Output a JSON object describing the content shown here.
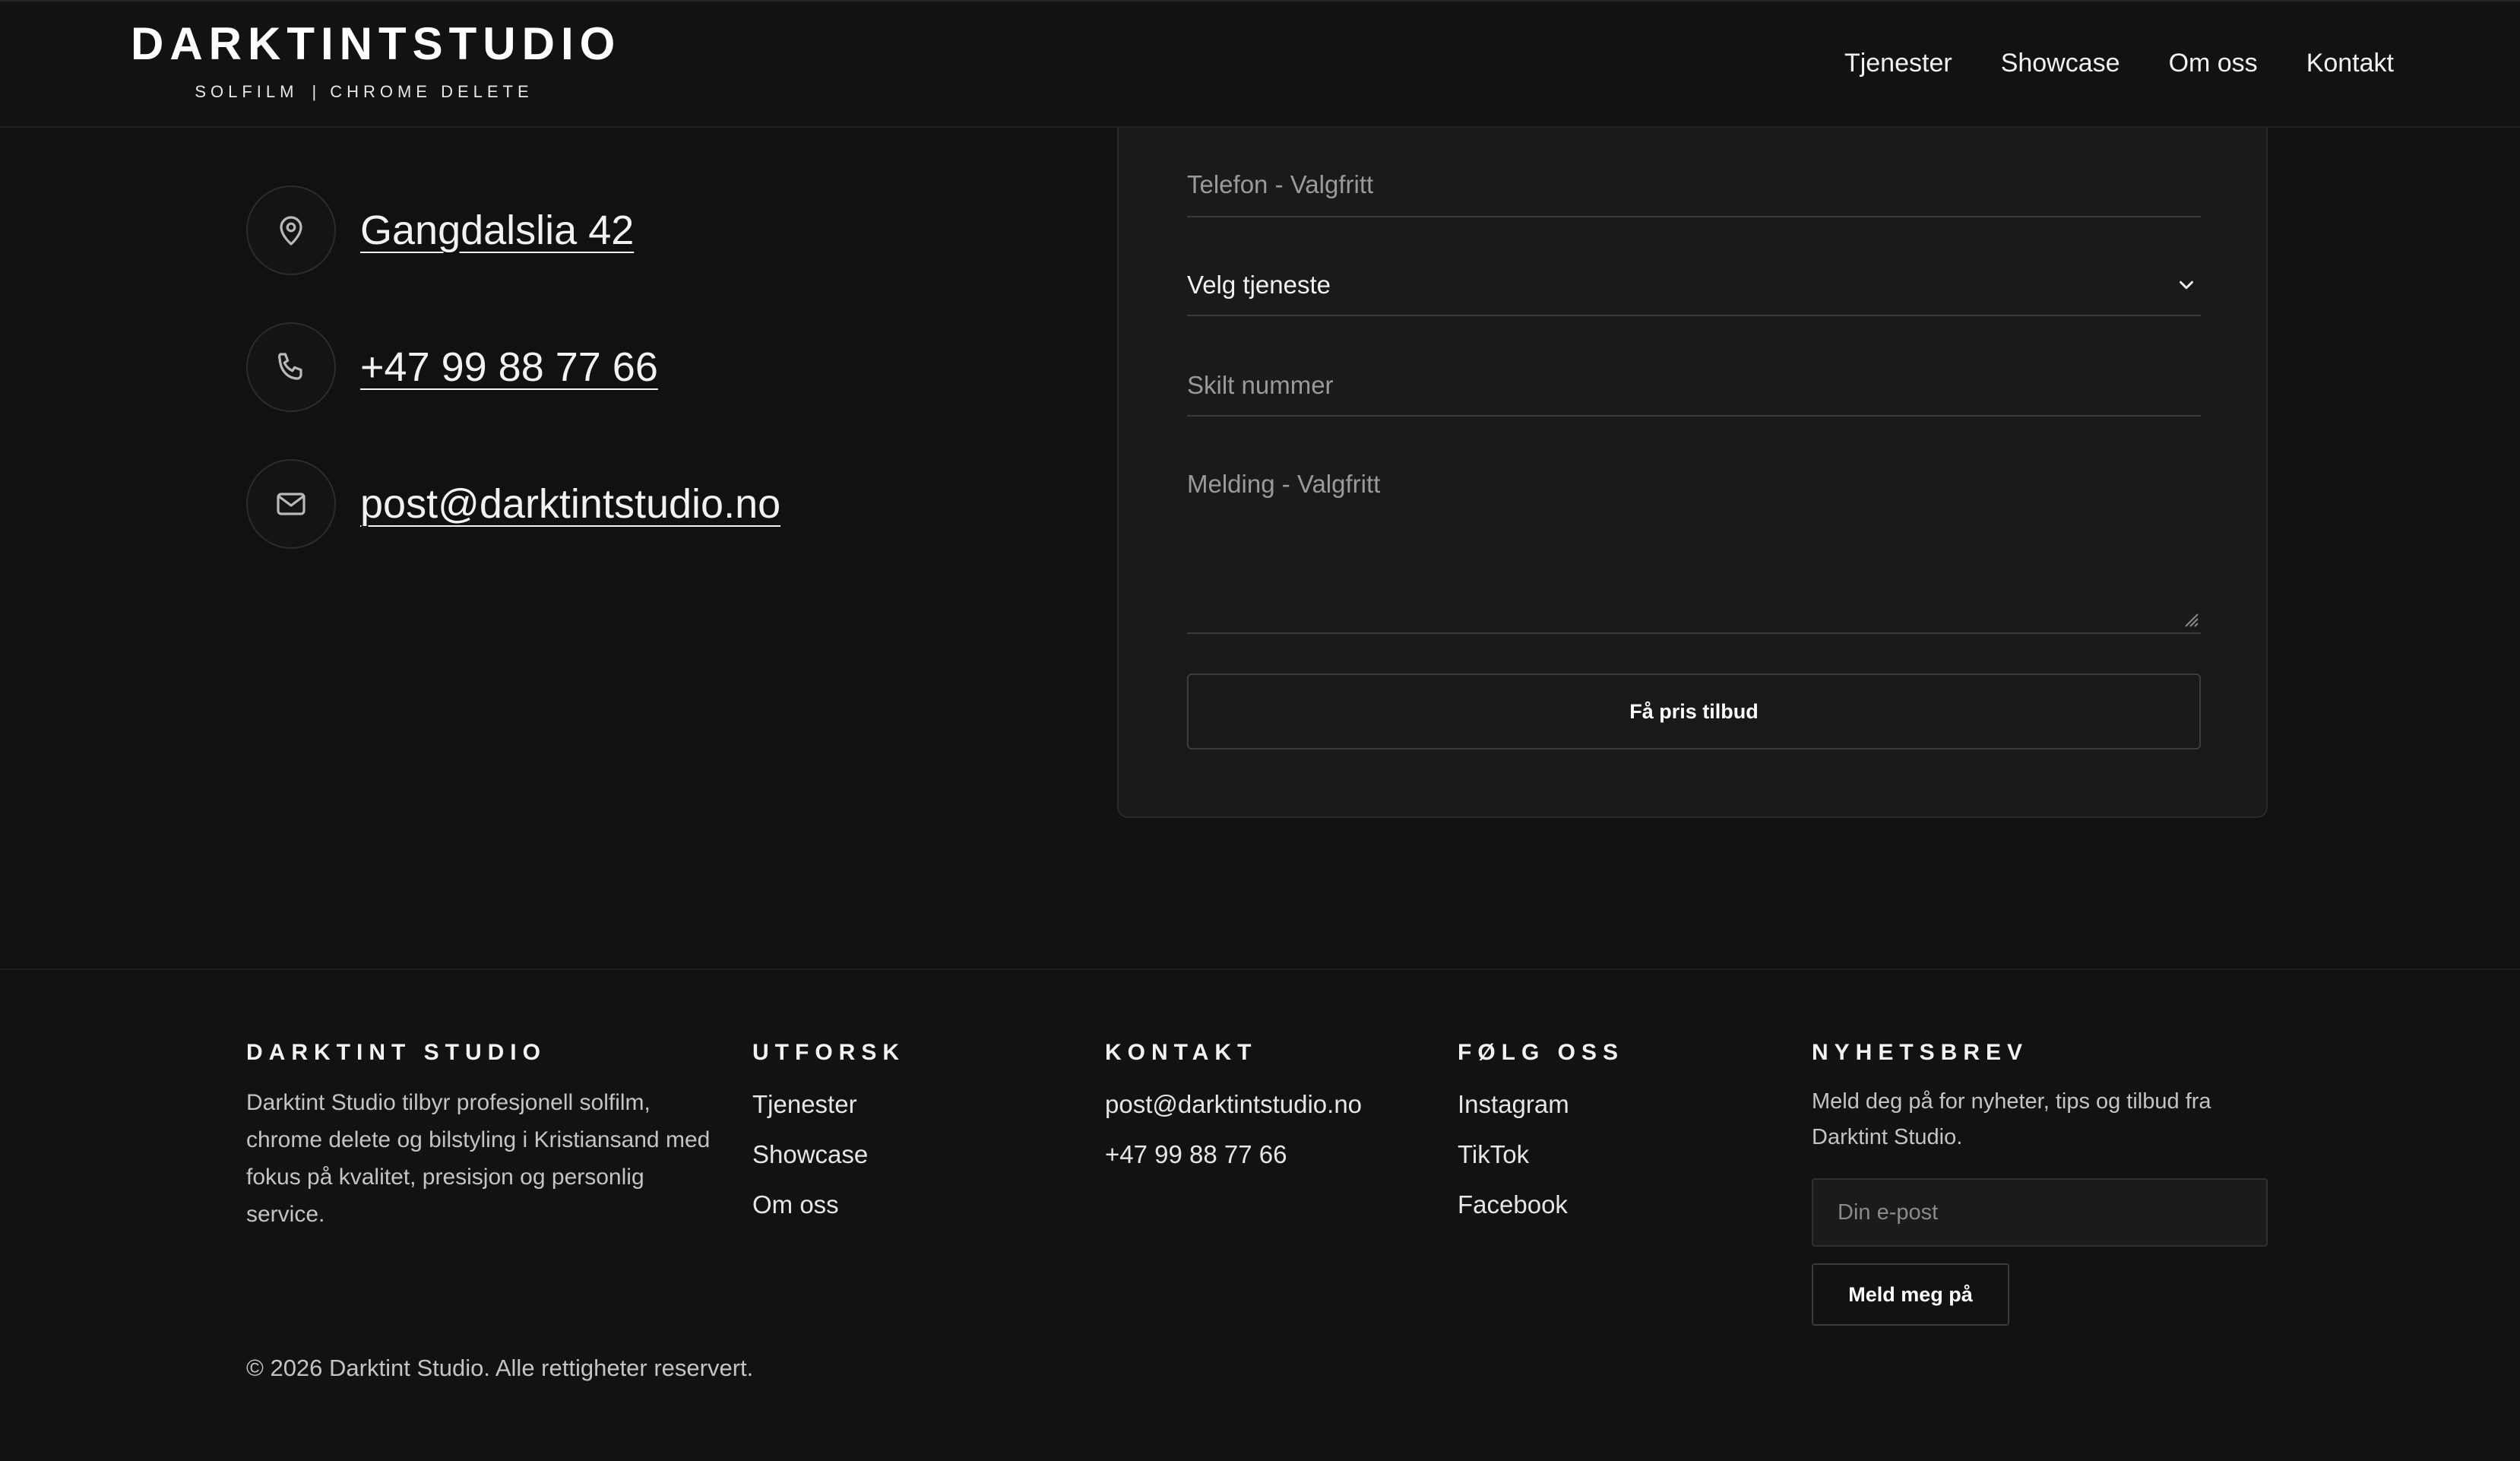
{
  "header": {
    "logo_main": "DARKTINTSTUDIO",
    "logo_sub_left": "SOLFILM",
    "logo_sub_sep": "|",
    "logo_sub_right": "CHROME DELETE",
    "nav": [
      "Tjenester",
      "Showcase",
      "Om oss",
      "Kontakt"
    ]
  },
  "contact": {
    "address": "Gangdalslia 42",
    "phone": "+47 99 88 77 66",
    "email": "post@darktintstudio.no"
  },
  "form": {
    "phone_placeholder": "Telefon - Valgfritt",
    "service_select": "Velg tjeneste",
    "plate_placeholder": "Skilt nummer",
    "message_placeholder": "Melding - Valgfritt",
    "submit_label": "Få pris tilbud"
  },
  "footer": {
    "about": {
      "heading": "DARKTINT STUDIO",
      "text": "Darktint Studio tilbyr profesjonell solfilm, chrome delete og bilstyling i Kristiansand med fokus på kvalitet, presisjon og personlig service."
    },
    "explore": {
      "heading": "UTFORSK",
      "links": [
        "Tjenester",
        "Showcase",
        "Om oss"
      ]
    },
    "contact": {
      "heading": "KONTAKT",
      "email": "post@darktintstudio.no",
      "phone": "+47 99 88 77 66"
    },
    "follow": {
      "heading": "FØLG OSS",
      "links": [
        "Instagram",
        "TikTok",
        "Facebook"
      ]
    },
    "newsletter": {
      "heading": "NYHETSBREV",
      "text": "Meld deg på for nyheter, tips og tilbud fra Darktint Studio.",
      "input_placeholder": "Din e-post",
      "button_label": "Meld meg på"
    },
    "copyright": "© 2026 Darktint Studio. Alle rettigheter reservert."
  },
  "colors": {
    "background": "#111111",
    "card": "#1a1a1a",
    "text": "#ececec",
    "muted": "#9a9a9a"
  }
}
